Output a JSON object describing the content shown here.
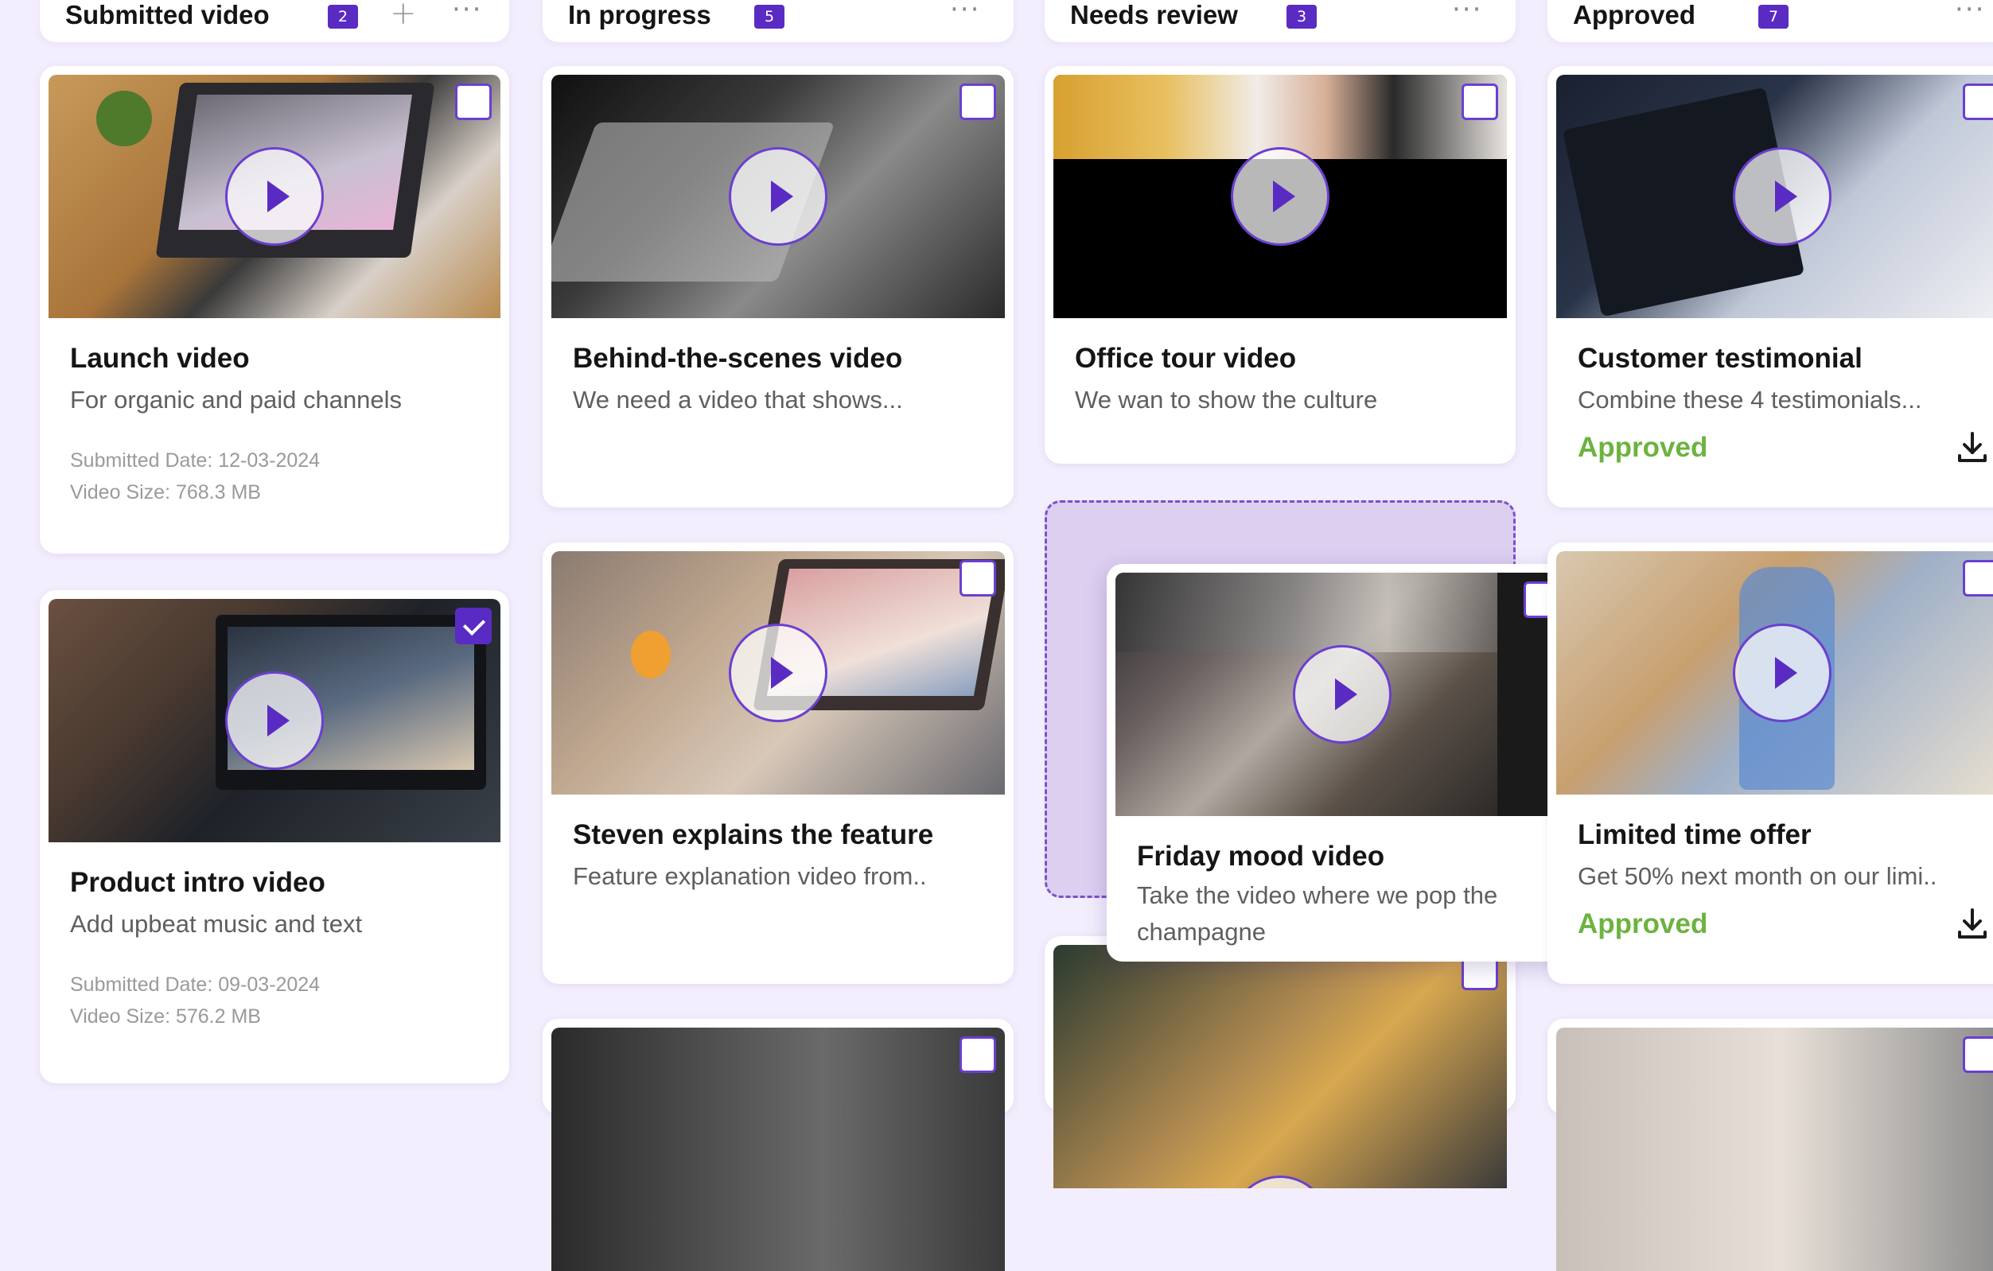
{
  "columns": [
    {
      "title": "Submitted video",
      "count": "2"
    },
    {
      "title": "In progress",
      "count": "5"
    },
    {
      "title": "Needs review",
      "count": "3"
    },
    {
      "title": "Approved",
      "count": "7"
    }
  ],
  "cards": {
    "launch": {
      "title": "Launch video",
      "desc": "For organic and paid channels",
      "date": "Submitted Date: 12-03-2024",
      "size": "Video Size: 768.3 MB",
      "checked": false
    },
    "product_intro": {
      "title": "Product intro video",
      "desc": "Add upbeat music and text",
      "date": "Submitted Date: 09-03-2024",
      "size": "Video Size: 576.2 MB",
      "checked": true
    },
    "behind_scenes": {
      "title": "Behind-the-scenes video",
      "desc": "We need a video that shows..."
    },
    "steven": {
      "title": "Steven explains the feature",
      "desc": "Feature explanation video from.."
    },
    "office_tour": {
      "title": "Office tour video",
      "desc": "We wan to show the culture"
    },
    "friday_mood": {
      "title": "Friday mood video",
      "desc": "Take the video where we pop the champagne"
    },
    "testimonial": {
      "title": "Customer testimonial",
      "desc": "Combine these 4 testimonials...",
      "status": "Approved"
    },
    "limited_offer": {
      "title": "Limited time offer",
      "desc": "Get 50% next month on our limi..",
      "status": "Approved"
    }
  },
  "icons": {
    "play": "play-icon",
    "checkbox": "checkbox-icon",
    "download": "download-icon",
    "add": "plus-icon",
    "more": "more-horizontal-icon"
  },
  "colors": {
    "background": "#f3eefd",
    "accent": "#5a2bc2",
    "approved": "#6cb33f",
    "dropzone": "#dccff0"
  }
}
